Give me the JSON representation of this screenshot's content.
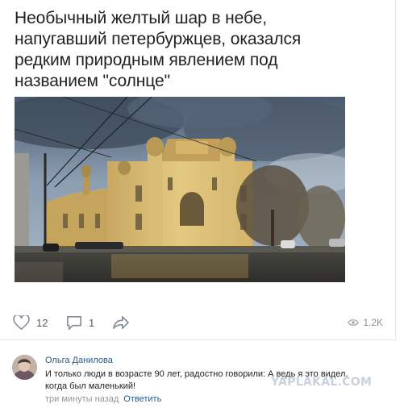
{
  "post": {
    "text_lines": [
      "Необычный желтый шар в небе,",
      "напугавший петербуржцев, оказался",
      "редким природным явлением под",
      "названием \"солнце\""
    ]
  },
  "actions": {
    "likes": "12",
    "comments": "1",
    "share_icon": "share-arrow-icon",
    "views": "1.2K"
  },
  "comment": {
    "author": "Ольга Данилова",
    "text_lines": [
      "И только люди в возрасте 90 лет, радостно говорили: А ведь я это видел,",
      "когда был маленький!"
    ],
    "time": "три минуты назад",
    "reply_label": "Ответить"
  },
  "watermark": "YAPLAKAL.COM",
  "colors": {
    "link": "#2a5885",
    "icon": "#828a99",
    "text": "#222222",
    "muted": "#939699"
  }
}
